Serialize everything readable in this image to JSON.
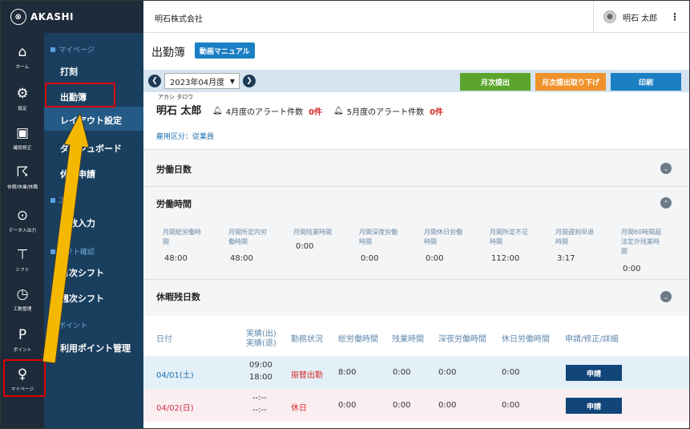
{
  "brand": {
    "name": "AKASHI"
  },
  "rail": [
    {
      "label": "ホーム",
      "icon": "home-icon",
      "glyph": "⌂"
    },
    {
      "label": "設定",
      "icon": "gear-icon",
      "glyph": "⚙"
    },
    {
      "label": "確認修正",
      "icon": "clipboard-check-icon",
      "glyph": "▣"
    },
    {
      "label": "休暇/休業/休職",
      "icon": "leaf-icon",
      "glyph": "☈"
    },
    {
      "label": "データ入出力",
      "icon": "download-circle-icon",
      "glyph": "⊙"
    },
    {
      "label": "シフト",
      "icon": "shift-icon",
      "glyph": "⊤"
    },
    {
      "label": "工数管理",
      "icon": "clock-icon",
      "glyph": "◷"
    },
    {
      "label": "ポイント",
      "icon": "point-p-icon",
      "glyph": "P"
    },
    {
      "label": "マイページ",
      "icon": "user-icon",
      "glyph": "♀"
    }
  ],
  "subnav": {
    "sections": [
      {
        "title": "マイページ"
      },
      {
        "title": "工"
      },
      {
        "title": "シフト確認"
      },
      {
        "title": "ポイント"
      }
    ],
    "items": [
      "打刻",
      "出勤簿",
      "レイアウト設定",
      "ダッシュボード",
      "休暇申請",
      "工数入力",
      "月次シフト",
      "週次シフト",
      "利用ポイント管理"
    ]
  },
  "topbar": {
    "company": "明石株式会社",
    "user": "明石 太郎",
    "kebab": "⋮"
  },
  "page": {
    "title": "出勤簿",
    "manual_label": "動画マニュアル"
  },
  "toolbar": {
    "month": "2023年04月度",
    "prev": "❮",
    "next": "❯",
    "caret": "▼",
    "btn_submit": "月次提出",
    "btn_withdraw": "月次提出取り下げ",
    "btn_print": "印刷",
    "colors": {
      "submit": "#5ba52c",
      "withdraw": "#f0922b",
      "print": "#1b7fc4"
    }
  },
  "employee": {
    "kana": "アカシ タロウ",
    "name": "明石 太郎",
    "alert1_label": "4月度のアラート件数",
    "alert1_count": "0件",
    "alert2_label": "5月度のアラート件数",
    "alert2_count": "0件",
    "type": "雇用区分：従業員"
  },
  "sections": {
    "workdays": "労働日数",
    "worktime": "労働時間",
    "leave": "休暇残日数"
  },
  "worktime": {
    "headers": [
      [
        "月間総労働時",
        "間"
      ],
      [
        "月間所定内労",
        "働時間"
      ],
      [
        "月間残業時間"
      ],
      [
        "月間深夜労働",
        "時間"
      ],
      [
        "月間休日労働",
        "時間"
      ],
      [
        "月間所定不足",
        "時間"
      ],
      [
        "月間遅刻早退",
        "時間"
      ],
      [
        "月間60時間超",
        "法定外残業時",
        "間"
      ]
    ],
    "values": [
      "48:00",
      "48:00",
      "0:00",
      "0:00",
      "0:00",
      "112:00",
      "3:17",
      "0:00"
    ]
  },
  "table": {
    "headers": {
      "date": "日付",
      "actual": [
        "実績(出)",
        "実績(退)"
      ],
      "status": "勤務状況",
      "total": "総労働時間",
      "overtime": "残業時間",
      "night": "深夜労働時間",
      "holiday": "休日労働時間",
      "request": "申請/修正/詳細"
    },
    "rows": [
      {
        "date": "04/01(土)",
        "in": "09:00",
        "out": "18:00",
        "status": "振替出勤",
        "total": "8:00",
        "overtime": "0:00",
        "night": "0:00",
        "holiday": "0:00",
        "apply": "申請"
      },
      {
        "date": "04/02(日)",
        "in": "--:--",
        "out": "--:--",
        "status": "休日",
        "total": "0:00",
        "overtime": "0:00",
        "night": "0:00",
        "holiday": "0:00",
        "apply": "申請"
      }
    ]
  }
}
